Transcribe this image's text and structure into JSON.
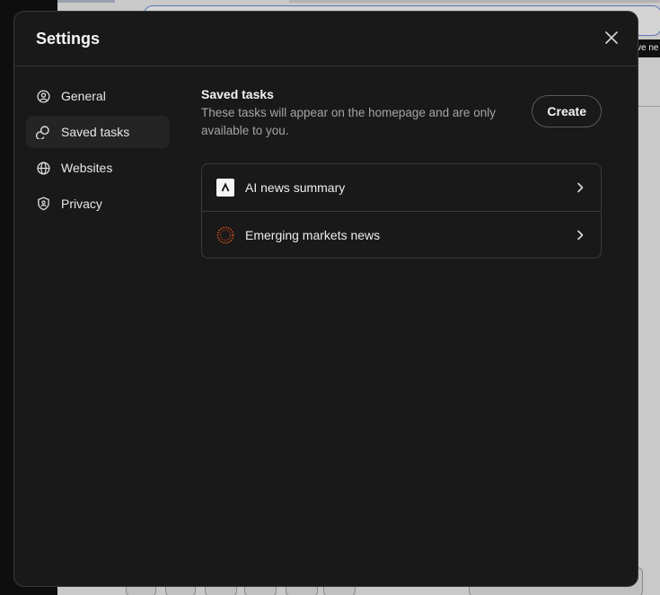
{
  "background": {
    "tooltip_text": "ve ne"
  },
  "modal": {
    "title": "Settings",
    "close_icon": "close-icon"
  },
  "sidebar": {
    "items": [
      {
        "label": "General",
        "icon": "user-circle-icon",
        "active": false
      },
      {
        "label": "Saved tasks",
        "icon": "saved-tasks-icon",
        "active": true
      },
      {
        "label": "Websites",
        "icon": "globe-icon",
        "active": false
      },
      {
        "label": "Privacy",
        "icon": "shield-icon",
        "active": false
      }
    ]
  },
  "saved_tasks": {
    "title": "Saved tasks",
    "description": "These tasks will appear on the homepage and are only available to you.",
    "create_label": "Create",
    "tasks": [
      {
        "label": "AI news summary",
        "icon": "caret-logo-icon"
      },
      {
        "label": "Emerging markets news",
        "icon": "dotted-ring-icon"
      }
    ]
  },
  "colors": {
    "modal_bg": "#191919",
    "active_nav_bg": "#242424",
    "accent_orange": "#e0541f"
  }
}
